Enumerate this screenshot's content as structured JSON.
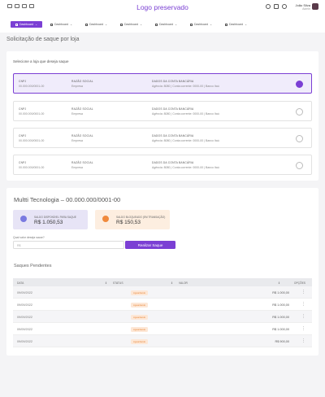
{
  "header": {
    "logo": "Logo preservado",
    "user_name": "João Silva",
    "user_role": "Admin"
  },
  "nav": [
    "Dashboard",
    "Dashboard",
    "Dashboard",
    "Dashboard",
    "Dashboard",
    "Dashboard",
    "Dashboard"
  ],
  "page_title": "Solicitação de saque por loja",
  "select_label": "Selecione a loja que deseja saque",
  "stores": [
    {
      "cnpj_label": "CNPJ",
      "cnpj": "00.000.000/0001-00",
      "razao_label": "RAZÃO SOCIAL",
      "razao": "Empresa",
      "banco_label": "DADOS DA CONTA BANCÁRIA",
      "banco": "Agência: 8080 | Conta corrente: 0000-00 | Banco Itaú",
      "selected": true
    },
    {
      "cnpj_label": "CNPJ",
      "cnpj": "00.000.000/0001-00",
      "razao_label": "RAZÃO SOCIAL",
      "razao": "Empresa",
      "banco_label": "DADOS DA CONTA BANCÁRIA",
      "banco": "Agência: 8080 | Conta corrente: 0000-00 | Banco Itaú",
      "selected": false
    },
    {
      "cnpj_label": "CNPJ",
      "cnpj": "00.000.000/0001-00",
      "razao_label": "RAZÃO SOCIAL",
      "razao": "Empresa",
      "banco_label": "DADOS DA CONTA BANCÁRIA",
      "banco": "Agência: 8080 | Conta corrente: 0000-00 | Banco Itaú",
      "selected": false
    },
    {
      "cnpj_label": "CNPJ",
      "cnpj": "00.000.000/0001-00",
      "razao_label": "RAZÃO SOCIAL",
      "razao": "Empresa",
      "banco_label": "DADOS DA CONTA BANCÁRIA",
      "banco": "Agência: 8080 | Conta corrente: 0000-00 | Banco Itaú",
      "selected": false
    }
  ],
  "detail": {
    "title": "Multti Tecnologia – 00.000.000/0001-00",
    "available_label": "SALDO DISPONÍVEL PARA SAQUE",
    "available_value": "R$ 1.050,53",
    "blocked_label": "SALDO BLOQUEADO (EM TRANSAÇÃO)",
    "blocked_value": "R$ 150,53",
    "amount_label": "Qual valor deseja sacar?",
    "amount_placeholder": "R$",
    "submit_label": "Realizar Saque"
  },
  "pending": {
    "title": "Saques Pendentes",
    "headers": {
      "data": "DATA",
      "status": "STATUS",
      "valor": "VALOR",
      "opcoes": "OPÇÕES"
    },
    "rows": [
      {
        "data": "09/09/2022",
        "status": "Aguardando",
        "valor": "R$ 1.000,00"
      },
      {
        "data": "09/09/2022",
        "status": "Aguardando",
        "valor": "R$ 1.000,00"
      },
      {
        "data": "09/09/2022",
        "status": "Aguardando",
        "valor": "R$ 1.000,00"
      },
      {
        "data": "09/09/2022",
        "status": "Aguardando",
        "valor": "R$ 1.000,00"
      },
      {
        "data": "09/09/2022",
        "status": "Aguardando",
        "valor": "R$ 900,00"
      }
    ]
  },
  "colors": {
    "accent": "#7b3fd4",
    "pending_badge": "#fde7d6"
  }
}
